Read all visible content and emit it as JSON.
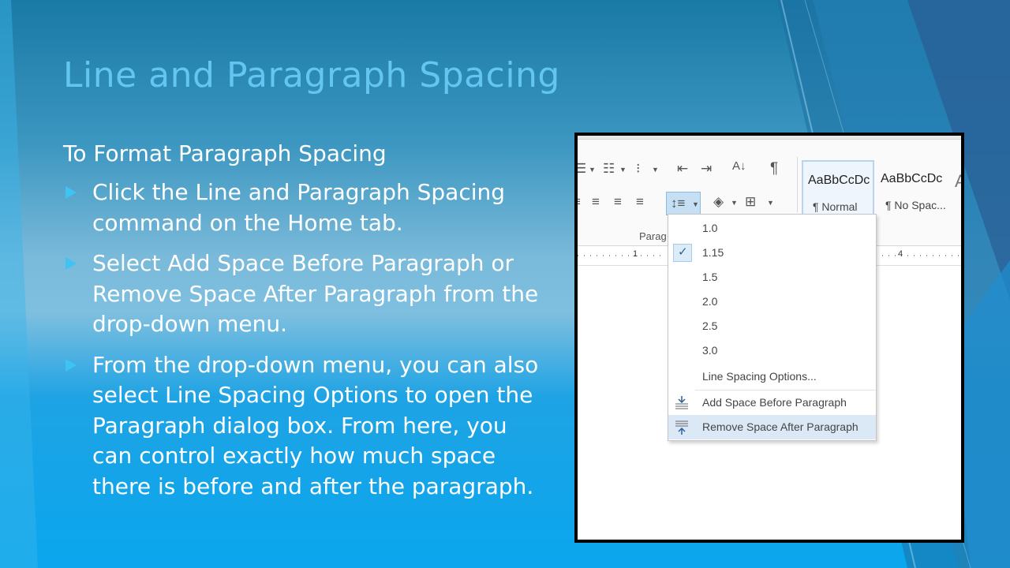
{
  "slide": {
    "title": "Line and Paragraph Spacing",
    "subtitle": "To Format Paragraph Spacing",
    "bullets": [
      "Click the Line and Paragraph Spacing command on the Home tab.",
      "Select Add Space Before Paragraph or Remove Space After Paragraph from the drop-down menu.",
      "From the drop-down menu, you can also select Line Spacing Options to open the Paragraph dialog box. From here, you can control exactly how much space there is before and after the paragraph."
    ]
  },
  "screenshot": {
    "ribbon": {
      "group_label": "Parag",
      "styles": [
        {
          "sample": "AaBbCcDc",
          "name": "¶ Normal"
        },
        {
          "sample": "AaBbCcDc",
          "name": "¶ No Spac..."
        }
      ]
    },
    "ruler": {
      "num_left": "1",
      "num_right": "4"
    },
    "spacing_menu": {
      "items": [
        "1.0",
        "1.15",
        "1.5",
        "2.0",
        "2.5",
        "3.0"
      ],
      "checked": "1.15",
      "options_label": "Line Spacing Options...",
      "add_before_label": "Add Space Before Paragraph",
      "remove_after_label": "Remove Space After Paragraph"
    }
  },
  "colors": {
    "title": "#62c6f0",
    "bullet_arrow": "#3fc3f5",
    "menu_hover": "#dbe8f6"
  }
}
